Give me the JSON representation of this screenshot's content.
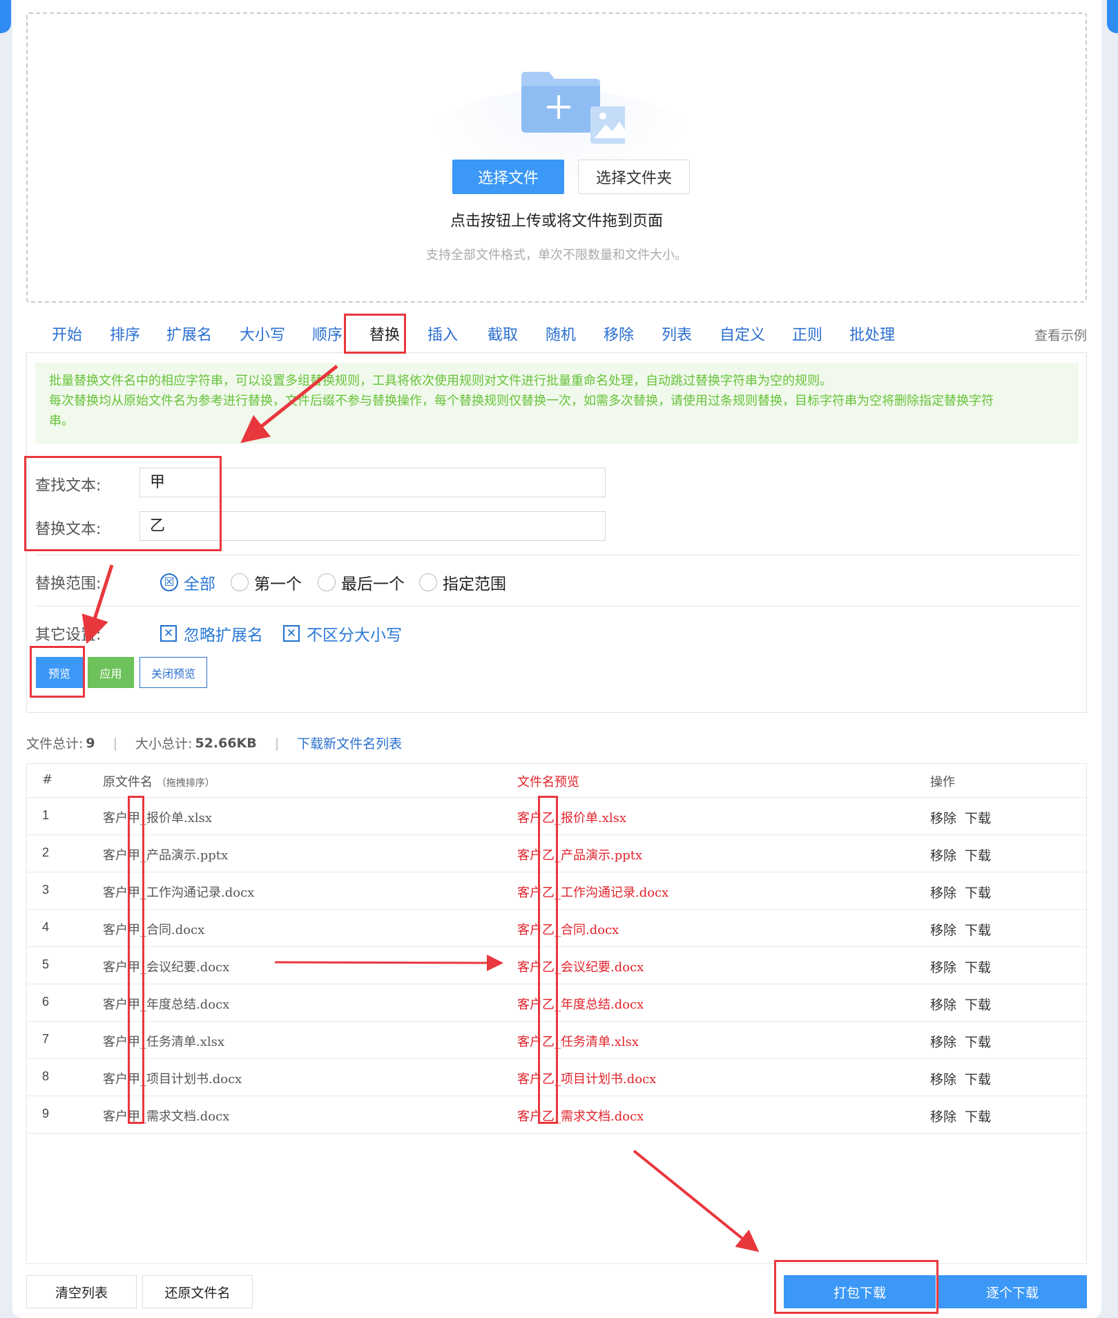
{
  "upload": {
    "select_file": "选择文件",
    "select_folder": "选择文件夹",
    "hint": "点击按钮上传或将文件拖到页面",
    "sub_hint": "支持全部文件格式，单次不限数量和文件大小。"
  },
  "tabs": [
    "开始",
    "排序",
    "扩展名",
    "大小写",
    "顺序",
    "替换",
    "插入",
    "截取",
    "随机",
    "移除",
    "列表",
    "自定义",
    "正则",
    "批处理"
  ],
  "active_tab": "替换",
  "view_example": "查看示例",
  "notice": {
    "line1": "批量替换文件名中的相应字符串，可以设置多组替换规则，工具将依次使用规则对文件进行批量重命名处理，自动跳过替换字符串为空的规则。",
    "line2": "每次替换均从原始文件名为参考进行替换，文件后缀不参与替换操作，每个替换规则仅替换一次，如需多次替换，请使用过条规则替换，目标字符串为空将删除指定替换字符",
    "line3": "串。"
  },
  "form": {
    "find_label": "查找文本:",
    "find_value": "甲",
    "replace_label": "替换文本:",
    "replace_value": "乙",
    "scope_label": "替换范围:",
    "scope_options": [
      "全部",
      "第一个",
      "最后一个",
      "指定范围"
    ],
    "scope_selected": "全部",
    "other_label": "其它设置:",
    "other_options": [
      "忽略扩展名",
      "不区分大小写"
    ]
  },
  "buttons": {
    "preview": "预览",
    "apply": "应用",
    "close_preview": "关闭预览"
  },
  "stats": {
    "file_total_label": "文件总计:",
    "file_total": "9",
    "size_total_label": "大小总计:",
    "size_total": "52.66KB",
    "download_list": "下载新文件名列表"
  },
  "table": {
    "headers": {
      "index": "#",
      "original": "原文件名",
      "original_note": "（拖拽排序）",
      "preview": "文件名预览",
      "actions": "操作"
    },
    "rows": [
      {
        "index": "1",
        "original": "客户甲_报价单.xlsx",
        "preview": "客户乙_报价单.xlsx"
      },
      {
        "index": "2",
        "original": "客户甲_产品演示.pptx",
        "preview": "客户乙_产品演示.pptx"
      },
      {
        "index": "3",
        "original": "客户甲_工作沟通记录.docx",
        "preview": "客户乙_工作沟通记录.docx"
      },
      {
        "index": "4",
        "original": "客户甲_合同.docx",
        "preview": "客户乙_合同.docx"
      },
      {
        "index": "5",
        "original": "客户甲_会议纪要.docx",
        "preview": "客户乙_会议纪要.docx"
      },
      {
        "index": "6",
        "original": "客户甲_年度总结.docx",
        "preview": "客户乙_年度总结.docx"
      },
      {
        "index": "7",
        "original": "客户甲_任务清单.xlsx",
        "preview": "客户乙_任务清单.xlsx"
      },
      {
        "index": "8",
        "original": "客户甲_项目计划书.docx",
        "preview": "客户乙_项目计划书.docx"
      },
      {
        "index": "9",
        "original": "客户甲_需求文档.docx",
        "preview": "客户乙_需求文档.docx"
      }
    ],
    "row_actions": [
      "移除",
      "下载"
    ]
  },
  "bottom": {
    "clear": "清空列表",
    "restore": "还原文件名",
    "pack_download": "打包下载",
    "each_download": "逐个下载"
  },
  "colors": {
    "primary": "#3b98f7",
    "link": "#2a6fd0",
    "success": "#6ec25b",
    "notice_bg": "#f0f9eb",
    "notice_text": "#67c23a",
    "preview_text": "#e0222a",
    "annotation": "#e8373d"
  }
}
